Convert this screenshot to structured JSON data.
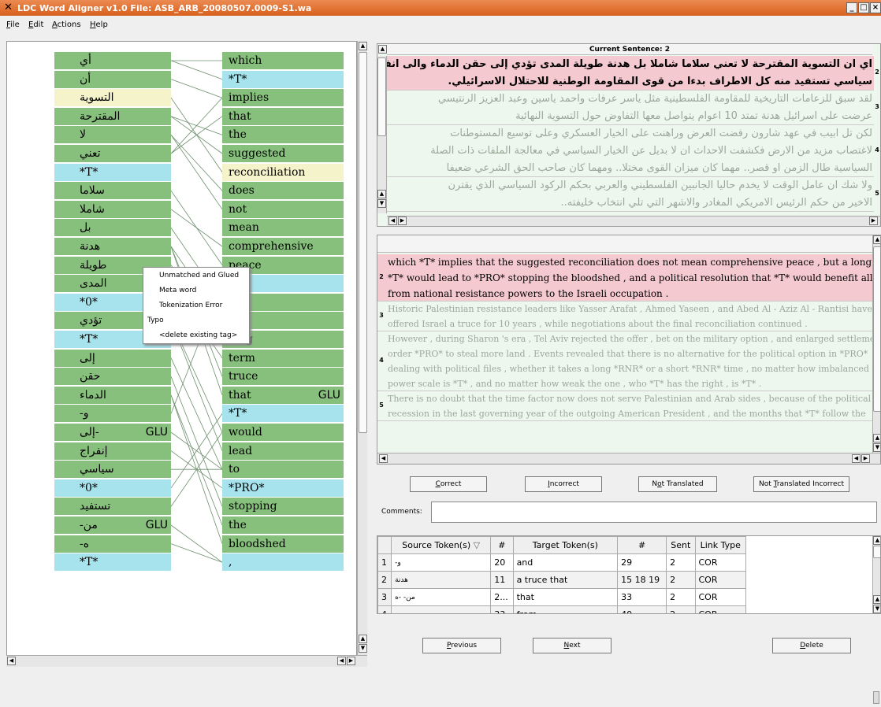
{
  "window": {
    "title": "LDC Word Aligner v1.0  File: ASB_ARB_20080507.0009-S1.wa",
    "buttons": {
      "minimize": "_",
      "maximize": "□",
      "close": "×"
    }
  },
  "menu": {
    "file": "File",
    "edit": "Edit",
    "actions": "Actions",
    "help": "Help"
  },
  "source_tokens": [
    {
      "text": "أي",
      "color": "green"
    },
    {
      "text": "أن",
      "color": "green"
    },
    {
      "text": "التسوية",
      "color": "yellow"
    },
    {
      "text": "المقترحة",
      "color": "green"
    },
    {
      "text": "لا",
      "color": "green"
    },
    {
      "text": "تعني",
      "color": "green"
    },
    {
      "text": "*T*",
      "color": "cyan"
    },
    {
      "text": "سلاما",
      "color": "green"
    },
    {
      "text": "شاملا",
      "color": "green"
    },
    {
      "text": "بل",
      "color": "green"
    },
    {
      "text": "هدنة",
      "color": "green"
    },
    {
      "text": "طويلة",
      "color": "green"
    },
    {
      "text": "المدى",
      "color": "green"
    },
    {
      "text": "*0*",
      "color": "cyan"
    },
    {
      "text": "تؤدي",
      "color": "green"
    },
    {
      "text": "*T*",
      "color": "cyan"
    },
    {
      "text": "إلى",
      "color": "green"
    },
    {
      "text": "حقن",
      "color": "green"
    },
    {
      "text": "الدماء",
      "color": "green"
    },
    {
      "text": "-و",
      "color": "green"
    },
    {
      "text": "إلى-",
      "color": "green",
      "tag": "GLU"
    },
    {
      "text": "إنفراج",
      "color": "green"
    },
    {
      "text": "سياسي",
      "color": "green"
    },
    {
      "text": "*0*",
      "color": "cyan"
    },
    {
      "text": "تستفيد",
      "color": "green"
    },
    {
      "text": "-من",
      "color": "green",
      "tag": "GLU"
    },
    {
      "text": "-ه",
      "color": "green"
    },
    {
      "text": "*T*",
      "color": "cyan"
    }
  ],
  "target_tokens": [
    {
      "text": "which",
      "color": "green"
    },
    {
      "text": "*T*",
      "color": "cyan"
    },
    {
      "text": "implies",
      "color": "green"
    },
    {
      "text": "that",
      "color": "green"
    },
    {
      "text": "the",
      "color": "green"
    },
    {
      "text": "suggested",
      "color": "green"
    },
    {
      "text": "reconciliation",
      "color": "yellow"
    },
    {
      "text": "does",
      "color": "green"
    },
    {
      "text": "not",
      "color": "green"
    },
    {
      "text": "mean",
      "color": "green"
    },
    {
      "text": "comprehensive",
      "color": "green"
    },
    {
      "text": "peace",
      "color": "green"
    },
    {
      "text": ",",
      "color": "cyan"
    },
    {
      "text": "but",
      "color": "green"
    },
    {
      "text": "a",
      "color": "green"
    },
    {
      "text": "long",
      "color": "green"
    },
    {
      "text": "term",
      "color": "green"
    },
    {
      "text": "truce",
      "color": "green"
    },
    {
      "text": "that",
      "color": "green",
      "tag": "GLU"
    },
    {
      "text": "*T*",
      "color": "cyan"
    },
    {
      "text": "would",
      "color": "green"
    },
    {
      "text": "lead",
      "color": "green"
    },
    {
      "text": "to",
      "color": "green"
    },
    {
      "text": "*PRO*",
      "color": "cyan"
    },
    {
      "text": "stopping",
      "color": "green"
    },
    {
      "text": "the",
      "color": "green"
    },
    {
      "text": "bloodshed",
      "color": "green"
    },
    {
      "text": ",",
      "color": "cyan"
    }
  ],
  "context_menu": [
    "Unmatched and Glued",
    "Meta word",
    "Tokenization Error",
    "Typo",
    "<delete existing tag>"
  ],
  "current_sentence": {
    "header": "Current Sentence: 2",
    "arabic_blocks": [
      {
        "num": "2",
        "lines": [
          "اي ان التسوية المقترحة لا تعني سلاما شاملا بل هدنة طويلة المدى تؤدي إلى حقن الدماء والى انفراج",
          "سياسي تستفيد منه كل الاطراف بدءا من قوى المقاومة الوطنية للاحتلال الاسرائيلي."
        ]
      },
      {
        "num": "3",
        "lines": [
          "لقد سبق للزعامات التاريخية للمقاومة الفلسطينية مثل ياسر عرفات واحمد ياسين وعبد العزيز الرنتيسي",
          "عرضت على اسرائيل هدنة تمتد 10 اعوام يتواصل معها التفاوض حول التسوية النهائية"
        ]
      },
      {
        "num": "4",
        "lines": [
          "لكن تل ابيب في عهد شارون رفضت العرض وراهنت على الخيار العسكري وعلى توسيع المستوطنات",
          "لاغتصاب مزيد من الارض فكشفت الاحداث ان لا بديل عن الخيار السياسي في معالجة الملفات ذات الصلة",
          "السياسية طال الزمن او قصر.. مهما كان ميزان القوى مختلا.. ومهما كان صاحب الحق الشرعي ضعيفا"
        ]
      },
      {
        "num": "5",
        "lines": [
          "ولا شك ان عامل الوقت لا يخدم حاليا الجانبين الفلسطيني والعربي بحكم الركود السياسي الذي يقترن",
          "الاخير من حكم الرئيس الامريكي المغادر والاشهر التي تلي انتخاب خليفته.."
        ]
      }
    ]
  },
  "translation": {
    "blocks": [
      {
        "num": "2",
        "lines": [
          "which *T* implies that the suggested reconciliation does not mean comprehensive peace , but a long term truce",
          "*T* would lead to *PRO* stopping the bloodshed , and a political resolution that *T* would benefit all parties",
          "from national resistance powers to the Israeli occupation ."
        ]
      },
      {
        "num": "3",
        "lines": [
          "Historic Palestinian resistance leaders like Yasser Arafat , Ahmed Yaseen , and Abed Al - Aziz Al - Rantisi have",
          "offered Israel a truce for 10 years , while negotiations about the final reconciliation continued ."
        ]
      },
      {
        "num": "4",
        "lines": [
          "However , during Sharon 's era , Tel Aviv rejected the offer , bet on the military option , and enlarged settlements in",
          "order *PRO* to steal more land . Events revealed that there is no alternative for the political option in *PRO*",
          "dealing with political files , whether it takes a long *RNR* or a short *RNR* time , no matter how imbalanced the",
          "power scale is *T* , and no matter how weak the one , who *T* has the right , is *T* ."
        ]
      },
      {
        "num": "5",
        "lines": [
          "There is no doubt that the time factor now does not serve Palestinian and Arab sides , because of the political",
          "recession in the last governing year of the outgoing American President , and the months that *T* follow the"
        ]
      }
    ]
  },
  "buttons": {
    "correct": {
      "pre": "",
      "key": "C",
      "post": "orrect"
    },
    "incorrect": {
      "pre": "",
      "key": "I",
      "post": "ncorrect"
    },
    "not_translated": {
      "pre": "N",
      "key": "o",
      "post": "t Translated"
    },
    "not_translated_incorrect": {
      "pre": "Not ",
      "key": "T",
      "post": "ranslated Incorrect"
    },
    "previous": {
      "pre": "",
      "key": "P",
      "post": "revious"
    },
    "next": {
      "pre": "",
      "key": "N",
      "post": "ext"
    },
    "delete": {
      "pre": "",
      "key": "D",
      "post": "elete"
    }
  },
  "comments": {
    "label": "Comments:",
    "value": ""
  },
  "links_table": {
    "headers": [
      "",
      "Source Token(s)",
      "#",
      "Target Token(s)",
      "#",
      "Sent",
      "Link Type"
    ],
    "sort_icon": "▽",
    "rows": [
      [
        "1",
        "-و",
        "20",
        "and",
        "29",
        "2",
        "COR"
      ],
      [
        "2",
        "هدنة",
        "11",
        "a truce that",
        "15 18 19",
        "2",
        "COR"
      ],
      [
        "3",
        "من- -ه",
        "2...",
        "that",
        "33",
        "2",
        "COR"
      ],
      [
        "4",
        "من",
        "33",
        "from",
        "40",
        "2",
        "COR"
      ]
    ]
  },
  "colors": {
    "green": "#87c07c",
    "cyan": "#a6e3ec",
    "yellow": "#f5f3c9",
    "current_highlight": "#f4c9d0",
    "other_sentence": "#eef7ee",
    "titlebar": "#e27430"
  }
}
